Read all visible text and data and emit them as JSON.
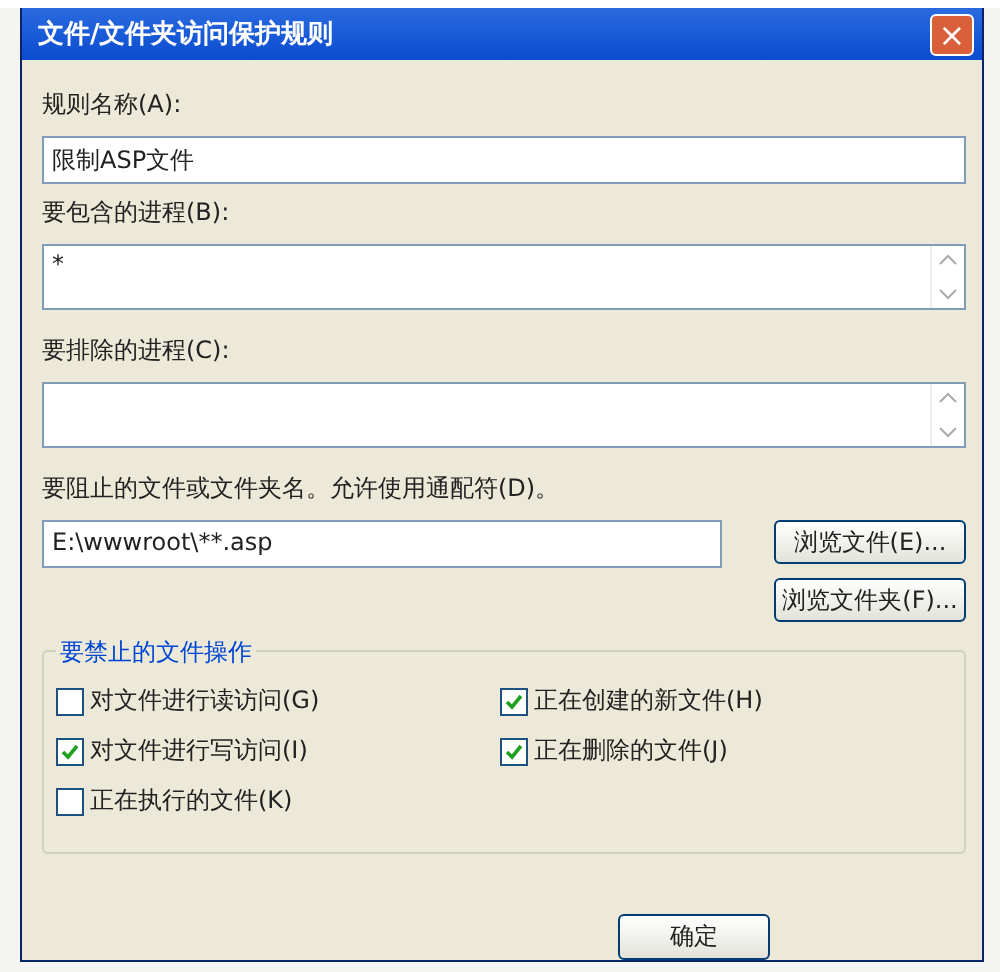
{
  "window": {
    "title": "文件/文件夹访问保护规则",
    "close": "×"
  },
  "rule_name": {
    "label": "规则名称(A):",
    "value": "限制ASP文件"
  },
  "include_processes": {
    "label": "要包含的进程(B):",
    "value": "*"
  },
  "exclude_processes": {
    "label": "要排除的进程(C):"
  },
  "blocked_path": {
    "label": "要阻止的文件或文件夹名。允许使用通配符(D)。",
    "value": "E:\\wwwroot\\**.asp"
  },
  "browse_buttons": [
    "浏览文件(E)...",
    "浏览文件夹(F)..."
  ],
  "operations": {
    "title": "要禁止的文件操作",
    "options": [
      {
        "label": "对文件进行读访问(G)",
        "checked": false
      },
      {
        "label": "正在创建的新文件(H)",
        "checked": true
      },
      {
        "label": "对文件进行写访问(I)",
        "checked": true
      },
      {
        "label": "正在删除的文件(J)",
        "checked": true
      },
      {
        "label": "正在执行的文件(K)",
        "checked": false
      }
    ]
  },
  "buttons": [
    "确定"
  ]
}
